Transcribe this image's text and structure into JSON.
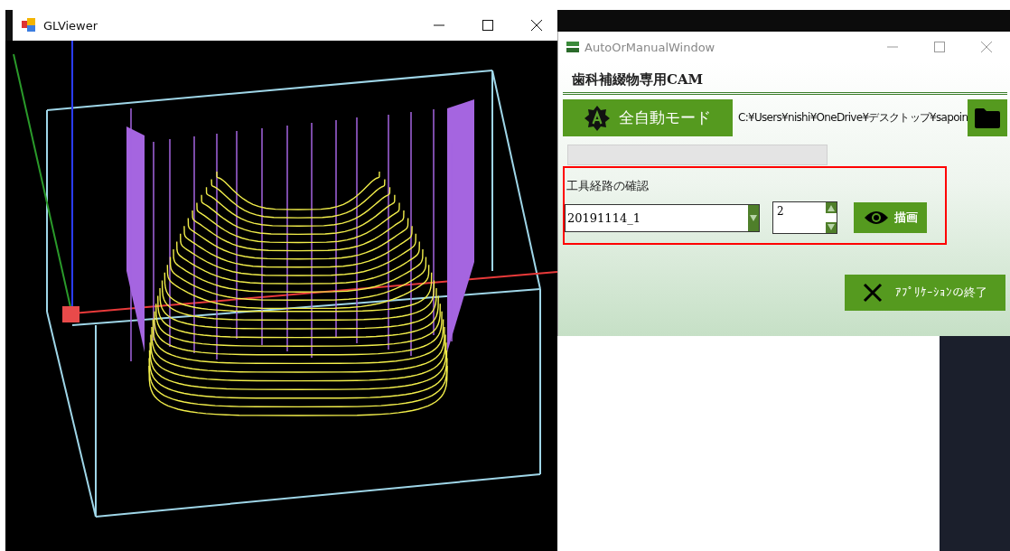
{
  "viewer_window": {
    "title": "GLViewer"
  },
  "cam_window": {
    "title": "AutoOrManualWindow",
    "heading": "歯科補綴物専用CAM",
    "auto_button": {
      "label": "全自動モード"
    },
    "folder_path": "C:¥Users¥nishi¥OneDrive¥デスクトップ¥sapoin",
    "progress": {
      "level": 0
    },
    "toolpath_section": {
      "label": "工具経路の確認",
      "file_select": {
        "value": "20191114_1"
      },
      "layer_spinner": {
        "value": "2"
      },
      "draw_button": {
        "label": "描画"
      }
    },
    "exit_button": {
      "label": "ｱﾌﾟﾘｹｰｼｮﾝの終了"
    }
  }
}
